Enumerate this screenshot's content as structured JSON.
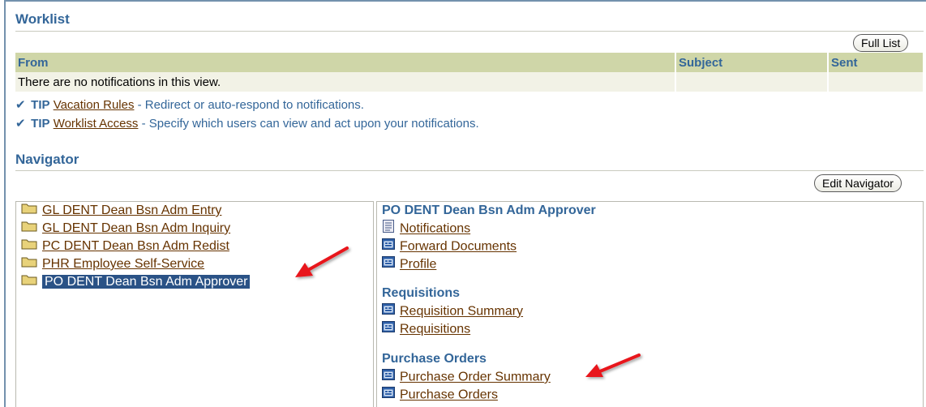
{
  "worklist": {
    "title": "Worklist",
    "full_list_button": "Full List",
    "columns": [
      "From",
      "Subject",
      "Sent"
    ],
    "empty_message": "There are no notifications in this view."
  },
  "tips": [
    {
      "label": "TIP",
      "link": "Vacation Rules",
      "text": " - Redirect or auto-respond to notifications."
    },
    {
      "label": "TIP",
      "link": "Worklist Access",
      "text": " - Specify which users can view and act upon your notifications."
    }
  ],
  "navigator": {
    "title": "Navigator",
    "edit_button": "Edit Navigator",
    "responsibilities": [
      "GL DENT Dean Bsn Adm Entry",
      "GL DENT Dean Bsn Adm Inquiry",
      "PC DENT Dean Bsn Adm Redist",
      "PHR Employee Self-Service",
      "PO DENT Dean Bsn Adm Approver"
    ],
    "selected_responsibility": "PO DENT Dean Bsn Adm Approver",
    "groups": [
      {
        "title": "PO DENT Dean Bsn Adm Approver",
        "items": [
          "Notifications",
          "Forward Documents",
          "Profile"
        ]
      },
      {
        "title": "Requisitions",
        "items": [
          "Requisition Summary",
          "Requisitions"
        ]
      },
      {
        "title": "Purchase Orders",
        "items": [
          "Purchase Order Summary",
          "Purchase Orders"
        ]
      }
    ]
  },
  "colors": {
    "header_text": "#336699",
    "link": "#663300",
    "table_header_bg": "#cfd6a8",
    "selected_bg": "#2a5286",
    "annotation_arrow": "#e8141b"
  }
}
